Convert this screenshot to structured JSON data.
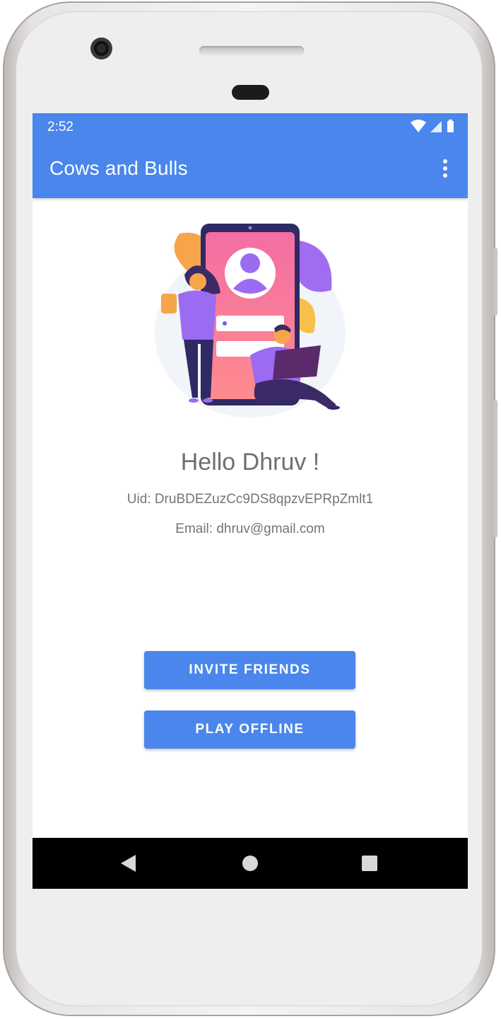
{
  "status_bar": {
    "time": "2:52"
  },
  "app_bar": {
    "title": "Cows and Bulls"
  },
  "profile": {
    "greeting": "Hello Dhruv !",
    "uid": "Uid: DruBDEZuzCc9DS8qpzvEPRpZmlt1",
    "email": "Email: dhruv@gmail.com"
  },
  "actions": {
    "invite_label": "INVITE FRIENDS",
    "offline_label": "PLAY OFFLINE"
  },
  "nav_bar": {
    "icons": [
      "back-icon",
      "home-icon",
      "recents-icon"
    ]
  },
  "colors": {
    "primary": "#4a86ec",
    "text_secondary": "#757575",
    "illustration_pink": "#f36ea3",
    "illustration_purple": "#9b6bf2",
    "illustration_orange": "#f6a54b"
  }
}
